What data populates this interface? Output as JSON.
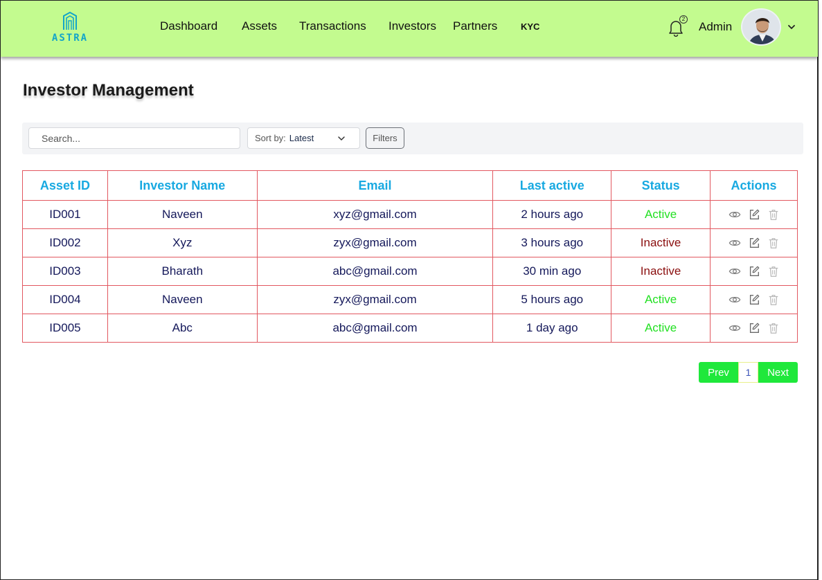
{
  "brand": {
    "name": "ASTRA"
  },
  "nav": {
    "items": [
      "Dashboard",
      "Assets",
      "Transactions",
      "Investors",
      "Partners",
      "KYC"
    ]
  },
  "header": {
    "notification_count": "2",
    "admin_label": "Admin"
  },
  "page": {
    "title": "Investor Management"
  },
  "toolbar": {
    "search_placeholder": "Search...",
    "sort_label": "Sort by:",
    "sort_value": "Latest",
    "filters_label": "Filters"
  },
  "table": {
    "columns": [
      "Asset ID",
      "Investor Name",
      "Email",
      "Last active",
      "Status",
      "Actions"
    ],
    "rows": [
      {
        "id": "ID001",
        "name": "Naveen",
        "email": "xyz@gmail.com",
        "last_active": "2 hours ago",
        "status": "Active"
      },
      {
        "id": "ID002",
        "name": "Xyz",
        "email": "zyx@gmail.com",
        "last_active": "3 hours ago",
        "status": "Inactive"
      },
      {
        "id": "ID003",
        "name": "Bharath",
        "email": "abc@gmail.com",
        "last_active": "30 min ago",
        "status": "Inactive"
      },
      {
        "id": "ID004",
        "name": "Naveen",
        "email": "zyx@gmail.com",
        "last_active": "5 hours ago",
        "status": "Active"
      },
      {
        "id": "ID005",
        "name": "Abc",
        "email": "abc@gmail.com",
        "last_active": "1 day ago",
        "status": "Active"
      }
    ],
    "row_action_icons": [
      "eye-icon",
      "edit-icon",
      "trash-icon"
    ]
  },
  "pagination": {
    "prev": "Prev",
    "current": "1",
    "next": "Next"
  },
  "colors": {
    "navbar_bg": "#c3fb8f",
    "brand": "#13a5c9",
    "header_text": "#18a9e1",
    "table_border": "#e2575f",
    "active": "#22e022",
    "inactive": "#8a0e0e",
    "pager": "#1fe83b"
  }
}
